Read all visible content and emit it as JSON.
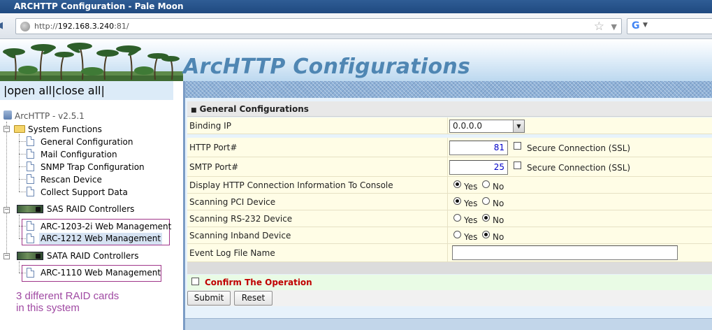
{
  "window": {
    "title": "ARCHTTP Configuration - Pale Moon"
  },
  "navbar": {
    "url_prefix": "http://",
    "url_host": "192.168.3.240",
    "url_suffix": ":81/",
    "search_engine_letter": "G"
  },
  "banner": {
    "title": "ArcHTTP Configurations"
  },
  "tree": {
    "open_close": "|open all|close all|",
    "root_label": "ArcHTTP - v2.5.1",
    "system_functions": {
      "label": "System Functions",
      "items": [
        "General Configuration",
        "Mail Configuration",
        "SNMP Trap Configuration",
        "Rescan Device",
        "Collect Support Data"
      ]
    },
    "sas_controllers": {
      "label": "SAS RAID Controllers",
      "items": [
        "ARC-1203-2i Web Management",
        "ARC-1212 Web Management"
      ]
    },
    "sata_controllers": {
      "label": "SATA RAID Controllers",
      "items": [
        "ARC-1110 Web Management"
      ]
    },
    "annotation_line1": "3 different RAID cards",
    "annotation_line2": "in this system"
  },
  "form": {
    "section_title": "General Configurations",
    "binding_ip": {
      "label": "Binding IP",
      "value": "0.0.0.0"
    },
    "http_port": {
      "label": "HTTP Port#",
      "value": "81",
      "ssl_label": "Secure Connection (SSL)",
      "ssl_checked": false
    },
    "smtp_port": {
      "label": "SMTP Port#",
      "value": "25",
      "ssl_label": "Secure Connection (SSL)",
      "ssl_checked": false
    },
    "display_http": {
      "label": "Display HTTP Connection Information To Console",
      "yes": "Yes",
      "no": "No",
      "selected": "Yes"
    },
    "scan_pci": {
      "label": "Scanning PCI Device",
      "yes": "Yes",
      "no": "No",
      "selected": "Yes"
    },
    "scan_rs232": {
      "label": "Scanning RS-232 Device",
      "yes": "Yes",
      "no": "No",
      "selected": "No"
    },
    "scan_inband": {
      "label": "Scanning Inband Device",
      "yes": "Yes",
      "no": "No",
      "selected": "No"
    },
    "event_log": {
      "label": "Event Log File Name",
      "value": ""
    },
    "confirm_label": "Confirm The Operation",
    "confirm_checked": false,
    "submit_label": "Submit",
    "reset_label": "Reset"
  },
  "colors": {
    "title_bar": "#2f5d95",
    "banner_title": "#4f86b3",
    "annotation": "#a04aa3",
    "confirm_text": "#c00000",
    "port_value": "#0000c8",
    "row_background": "#fffde6"
  }
}
